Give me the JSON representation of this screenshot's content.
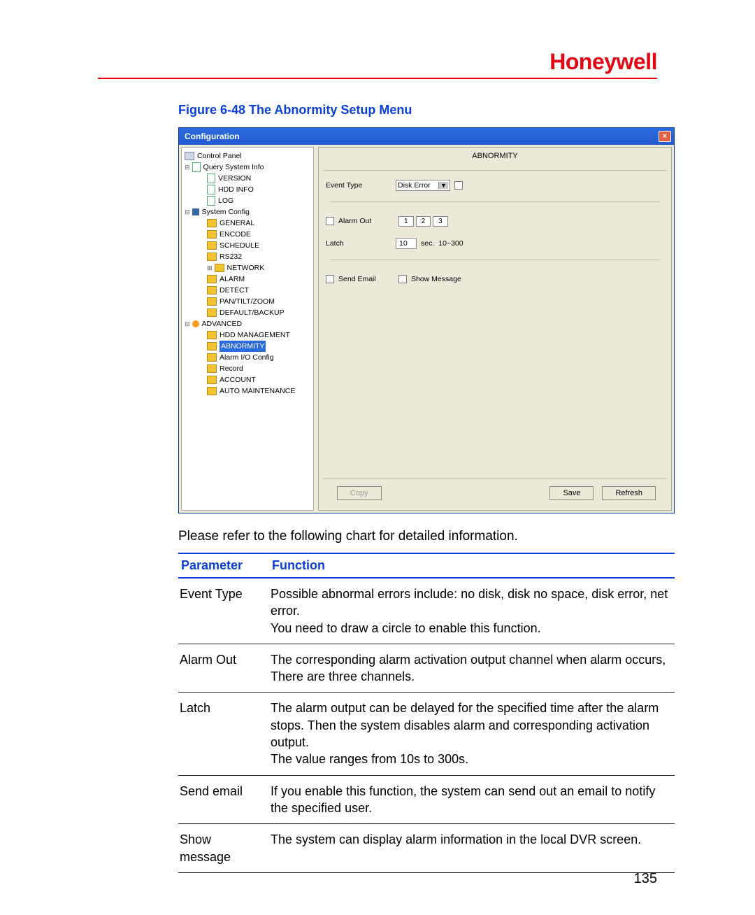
{
  "brand": "Honeywell",
  "figure_caption": "Figure 6-48 The Abnormity Setup Menu",
  "screenshot": {
    "window_title": "Configuration",
    "close_glyph": "×",
    "panel_title": "ABNORMITY",
    "tree": {
      "control_panel": "Control Panel",
      "query": "Query System Info",
      "version": "VERSION",
      "hdd_info": "HDD INFO",
      "log": "LOG",
      "system_config": "System Config",
      "general": "GENERAL",
      "encode": "ENCODE",
      "schedule": "SCHEDULE",
      "rs232": "RS232",
      "network": "NETWORK",
      "alarm": "ALARM",
      "detect": "DETECT",
      "ptz": "PAN/TILT/ZOOM",
      "default": "DEFAULT/BACKUP",
      "advanced": "ADVANCED",
      "hdd_mgmt": "HDD MANAGEMENT",
      "abnormity": "ABNORMITY",
      "alarm_io": "Alarm I/O Config",
      "record": "Record",
      "account": "ACCOUNT",
      "auto_maint": "AUTO MAINTENANCE"
    },
    "form": {
      "event_type_label": "Event Type",
      "event_type_value": "Disk Error",
      "alarm_out_label": "Alarm Out",
      "alarm_out_buttons": [
        "1",
        "2",
        "3"
      ],
      "latch_label": "Latch",
      "latch_value": "10",
      "latch_unit": "sec.",
      "latch_range": "10~300",
      "send_email_label": "Send Email",
      "show_message_label": "Show Message"
    },
    "buttons": {
      "copy": "Copy",
      "save": "Save",
      "refresh": "Refresh"
    }
  },
  "intro": "Please refer to the following chart for detailed information.",
  "table": {
    "head_param": "Parameter",
    "head_func": "Function",
    "rows": [
      {
        "param": "Event Type",
        "func": "Possible abnormal errors include: no disk, disk no space, disk error, net error.\nYou need to draw a circle to enable this function."
      },
      {
        "param": "Alarm Out",
        "func": "The corresponding alarm activation output channel when alarm occurs, There are three channels."
      },
      {
        "param": "Latch",
        "func": "The alarm output can be delayed for the specified time after the alarm stops. Then the system disables alarm and corresponding activation output.\nThe value ranges from 10s to 300s."
      },
      {
        "param": "Send email",
        "func": "If you enable this function, the system can send out an email to notify the specified user."
      },
      {
        "param": "Show message",
        "func": "The system can display alarm information in the local DVR screen."
      }
    ]
  },
  "page_number": "135"
}
